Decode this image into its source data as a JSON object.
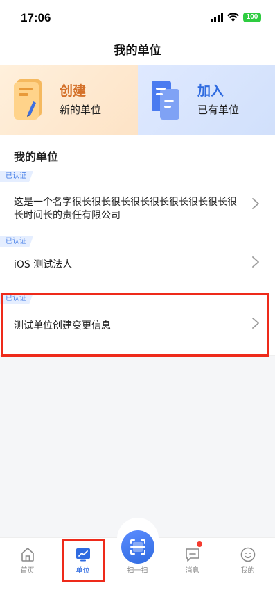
{
  "status_bar": {
    "time": "17:06",
    "battery": "100"
  },
  "nav": {
    "title": "我的单位"
  },
  "actions": {
    "create": {
      "title": "创建",
      "subtitle": "新的单位"
    },
    "join": {
      "title": "加入",
      "subtitle": "已有单位"
    }
  },
  "section": {
    "title": "我的单位"
  },
  "units": [
    {
      "badge": "已认证",
      "name": "这是一个名字很长很长很长很长很长很长很长很长很长时间长的责任有限公司"
    },
    {
      "badge": "已认证",
      "name": "iOS 测试法人"
    },
    {
      "badge": "已认证",
      "name": "测试单位创建变更信息"
    }
  ],
  "tabs": [
    {
      "label": "首页",
      "icon": "home-icon"
    },
    {
      "label": "单位",
      "icon": "unit-icon",
      "active": true
    },
    {
      "label": "扫一扫",
      "icon": "scan-icon"
    },
    {
      "label": "消息",
      "icon": "message-icon",
      "has_dot": true
    },
    {
      "label": "我的",
      "icon": "profile-icon"
    }
  ],
  "colors": {
    "accent": "#2f6be0",
    "create_accent": "#d4712a",
    "highlight": "#ee2a1a"
  }
}
